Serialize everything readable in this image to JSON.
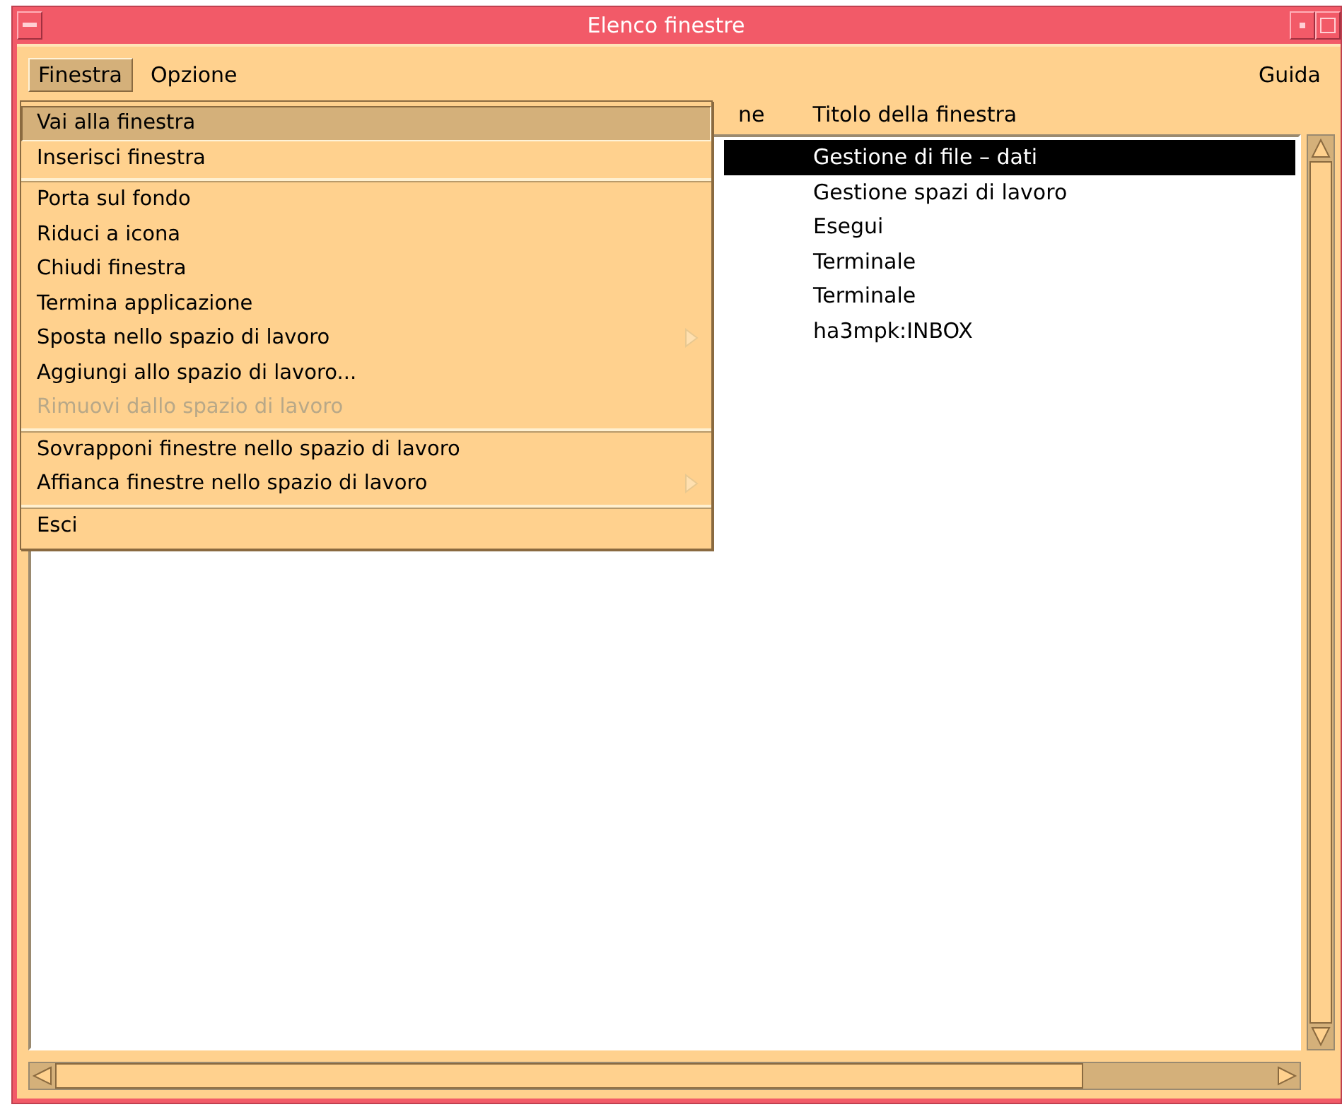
{
  "window": {
    "title": "Elenco finestre"
  },
  "menubar": [
    {
      "label": "Finestra",
      "selected": true
    },
    {
      "label": "Opzione",
      "selected": false
    }
  ],
  "help_menu": {
    "label": "Guida"
  },
  "menu": {
    "groups": [
      [
        {
          "label": "Vai alla finestra",
          "selected": true,
          "disabled": false,
          "submenu": false
        },
        {
          "label": "Inserisci finestra",
          "selected": false,
          "disabled": false,
          "submenu": false
        }
      ],
      [
        {
          "label": "Porta sul fondo",
          "selected": false,
          "disabled": false,
          "submenu": false
        },
        {
          "label": "Riduci a icona",
          "selected": false,
          "disabled": false,
          "submenu": false
        },
        {
          "label": "Chiudi finestra",
          "selected": false,
          "disabled": false,
          "submenu": false
        },
        {
          "label": "Termina applicazione",
          "selected": false,
          "disabled": false,
          "submenu": false
        },
        {
          "label": "Sposta nello spazio di lavoro",
          "selected": false,
          "disabled": false,
          "submenu": true
        },
        {
          "label": "Aggiungi allo spazio di lavoro...",
          "selected": false,
          "disabled": false,
          "submenu": false
        },
        {
          "label": "Rimuovi dallo spazio di lavoro",
          "selected": false,
          "disabled": true,
          "submenu": false
        }
      ],
      [
        {
          "label": "Sovrapponi finestre nello spazio di lavoro",
          "selected": false,
          "disabled": false,
          "submenu": false
        },
        {
          "label": "Affianca finestre nello spazio di lavoro",
          "selected": false,
          "disabled": false,
          "submenu": true
        }
      ],
      [
        {
          "label": "Esci",
          "selected": false,
          "disabled": false,
          "submenu": false
        }
      ]
    ]
  },
  "table": {
    "columns": [
      "ne",
      "Titolo della finestra"
    ],
    "rows": [
      {
        "title": "Gestione di file – dati",
        "selected": true
      },
      {
        "title": "Gestione spazi di lavoro",
        "selected": false
      },
      {
        "title": "Esegui",
        "selected": false
      },
      {
        "title": "Terminale",
        "selected": false
      },
      {
        "title": "Terminale",
        "selected": false
      },
      {
        "title": "ha3mpk:INBOX",
        "selected": false
      }
    ]
  }
}
